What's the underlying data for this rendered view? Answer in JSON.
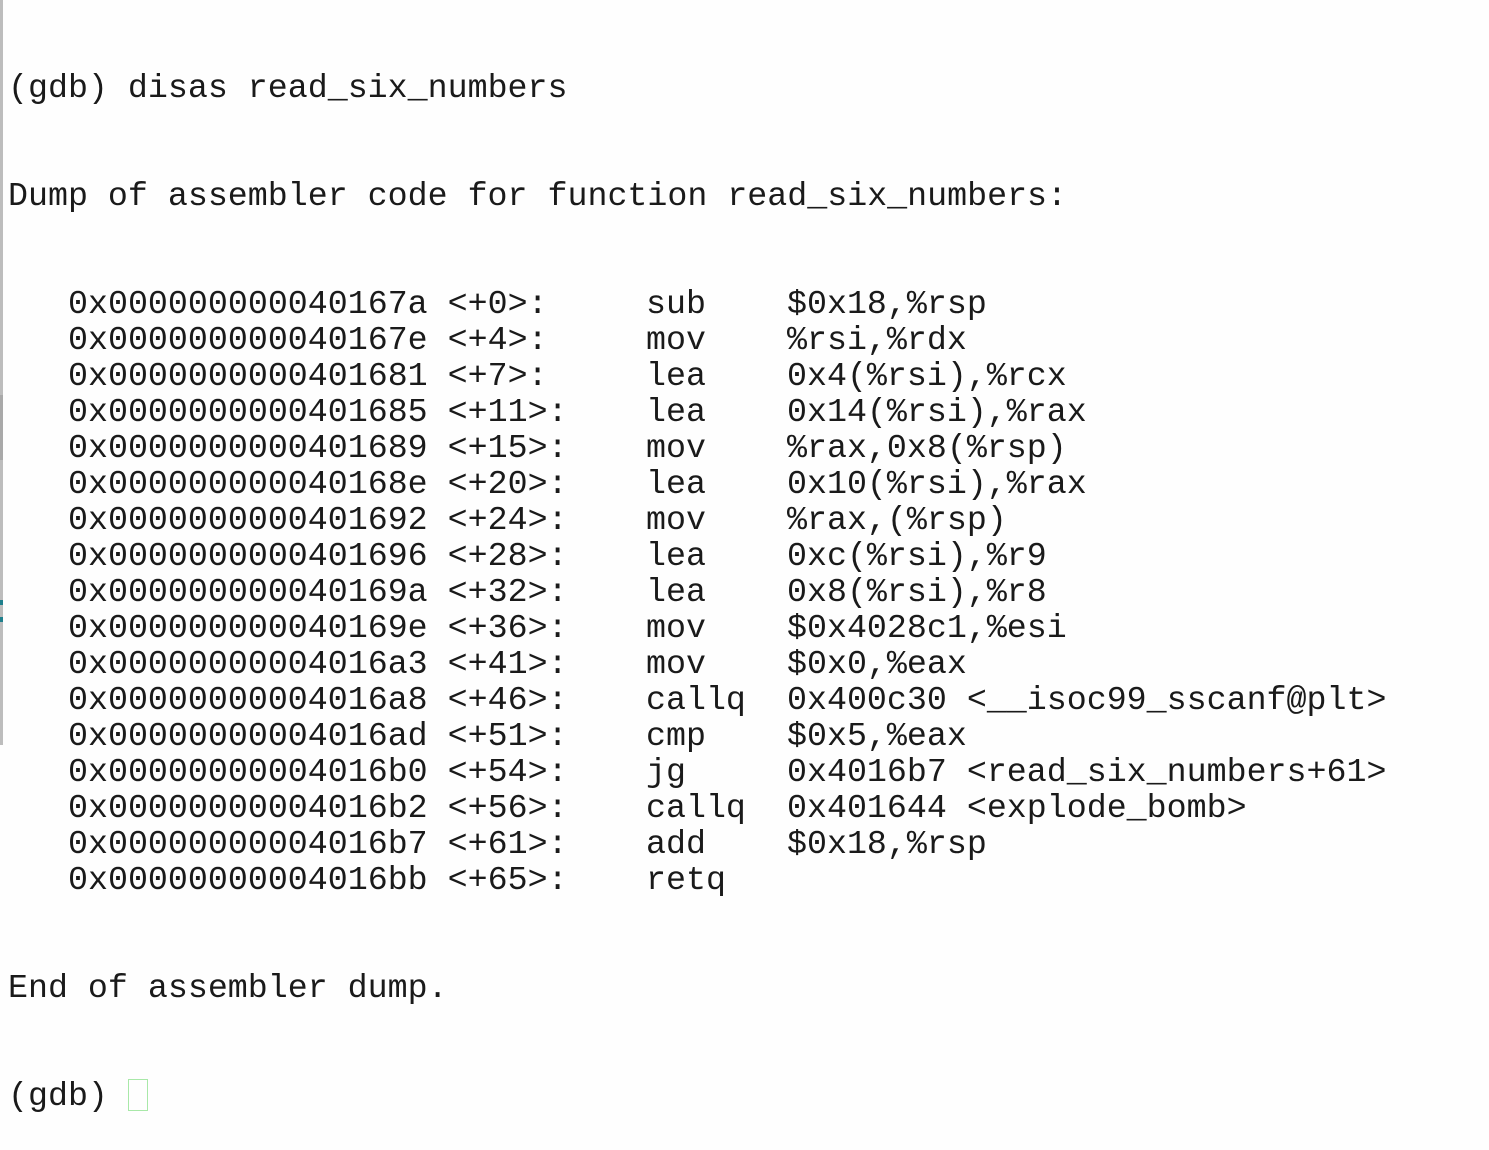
{
  "terminal": {
    "command_prompt": "(gdb)",
    "command": "disas read_six_numbers",
    "header": "Dump of assembler code for function read_six_numbers:",
    "instructions": [
      {
        "address": "0x000000000040167a",
        "offset": "<+0>:",
        "opcode": "sub",
        "operands": "$0x18,%rsp"
      },
      {
        "address": "0x000000000040167e",
        "offset": "<+4>:",
        "opcode": "mov",
        "operands": "%rsi,%rdx"
      },
      {
        "address": "0x0000000000401681",
        "offset": "<+7>:",
        "opcode": "lea",
        "operands": "0x4(%rsi),%rcx"
      },
      {
        "address": "0x0000000000401685",
        "offset": "<+11>:",
        "opcode": "lea",
        "operands": "0x14(%rsi),%rax"
      },
      {
        "address": "0x0000000000401689",
        "offset": "<+15>:",
        "opcode": "mov",
        "operands": "%rax,0x8(%rsp)"
      },
      {
        "address": "0x000000000040168e",
        "offset": "<+20>:",
        "opcode": "lea",
        "operands": "0x10(%rsi),%rax"
      },
      {
        "address": "0x0000000000401692",
        "offset": "<+24>:",
        "opcode": "mov",
        "operands": "%rax,(%rsp)"
      },
      {
        "address": "0x0000000000401696",
        "offset": "<+28>:",
        "opcode": "lea",
        "operands": "0xc(%rsi),%r9"
      },
      {
        "address": "0x000000000040169a",
        "offset": "<+32>:",
        "opcode": "lea",
        "operands": "0x8(%rsi),%r8"
      },
      {
        "address": "0x000000000040169e",
        "offset": "<+36>:",
        "opcode": "mov",
        "operands": "$0x4028c1,%esi"
      },
      {
        "address": "0x00000000004016a3",
        "offset": "<+41>:",
        "opcode": "mov",
        "operands": "$0x0,%eax"
      },
      {
        "address": "0x00000000004016a8",
        "offset": "<+46>:",
        "opcode": "callq",
        "operands": "0x400c30 <__isoc99_sscanf@plt>"
      },
      {
        "address": "0x00000000004016ad",
        "offset": "<+51>:",
        "opcode": "cmp",
        "operands": "$0x5,%eax"
      },
      {
        "address": "0x00000000004016b0",
        "offset": "<+54>:",
        "opcode": "jg",
        "operands": "0x4016b7 <read_six_numbers+61>"
      },
      {
        "address": "0x00000000004016b2",
        "offset": "<+56>:",
        "opcode": "callq",
        "operands": "0x401644 <explode_bomb>"
      },
      {
        "address": "0x00000000004016b7",
        "offset": "<+61>:",
        "opcode": "add",
        "operands": "$0x18,%rsp"
      },
      {
        "address": "0x00000000004016bb",
        "offset": "<+65>:",
        "opcode": "retq",
        "operands": ""
      }
    ],
    "footer": "End of assembler dump.",
    "final_prompt": "(gdb)",
    "input_value": ""
  },
  "colors": {
    "background": "#fefefe",
    "text": "#1a1a1a",
    "cursor_outline": "#a8e8a8",
    "left_border": "#bdbdbd",
    "teal_fragment": "#1f7f8c"
  }
}
